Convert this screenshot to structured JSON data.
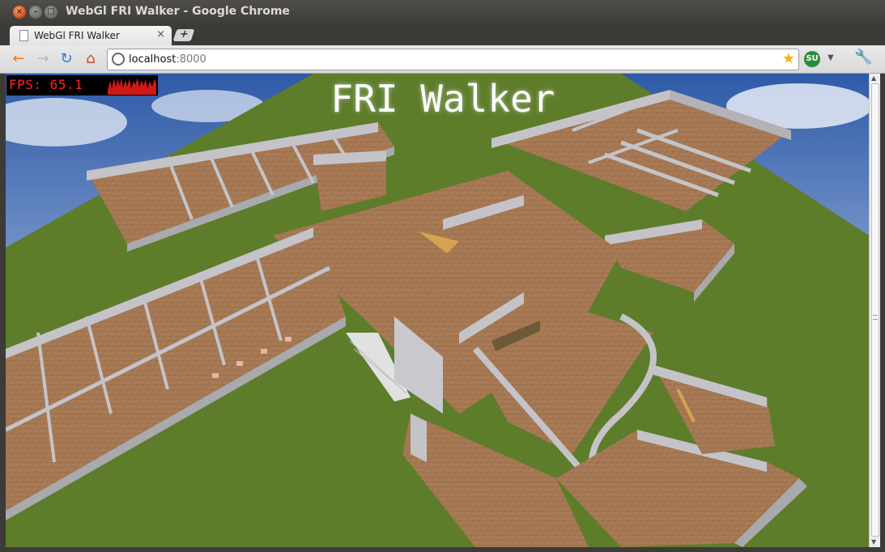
{
  "window": {
    "title": "WebGl FRI Walker - Google Chrome"
  },
  "tab": {
    "label": "WebGl FRI Walker",
    "close_glyph": "×",
    "new_tab_glyph": "+"
  },
  "toolbar": {
    "url_host": "localhost",
    "url_port": ":8000",
    "back_icon": "←",
    "forward_icon": "→",
    "reload_icon": "↻",
    "home_icon": "⌂",
    "bookmark_icon": "★",
    "extension_label": "SU",
    "wrench_icon": "🔧"
  },
  "page": {
    "fps_label": "FPS:",
    "fps_value": "65.1",
    "title": "FRI Walker"
  },
  "colors": {
    "grass": "#5d7d2b",
    "walls": "#c4c4c8",
    "floor": "#a87a55",
    "fps_red": "#ff2020"
  }
}
